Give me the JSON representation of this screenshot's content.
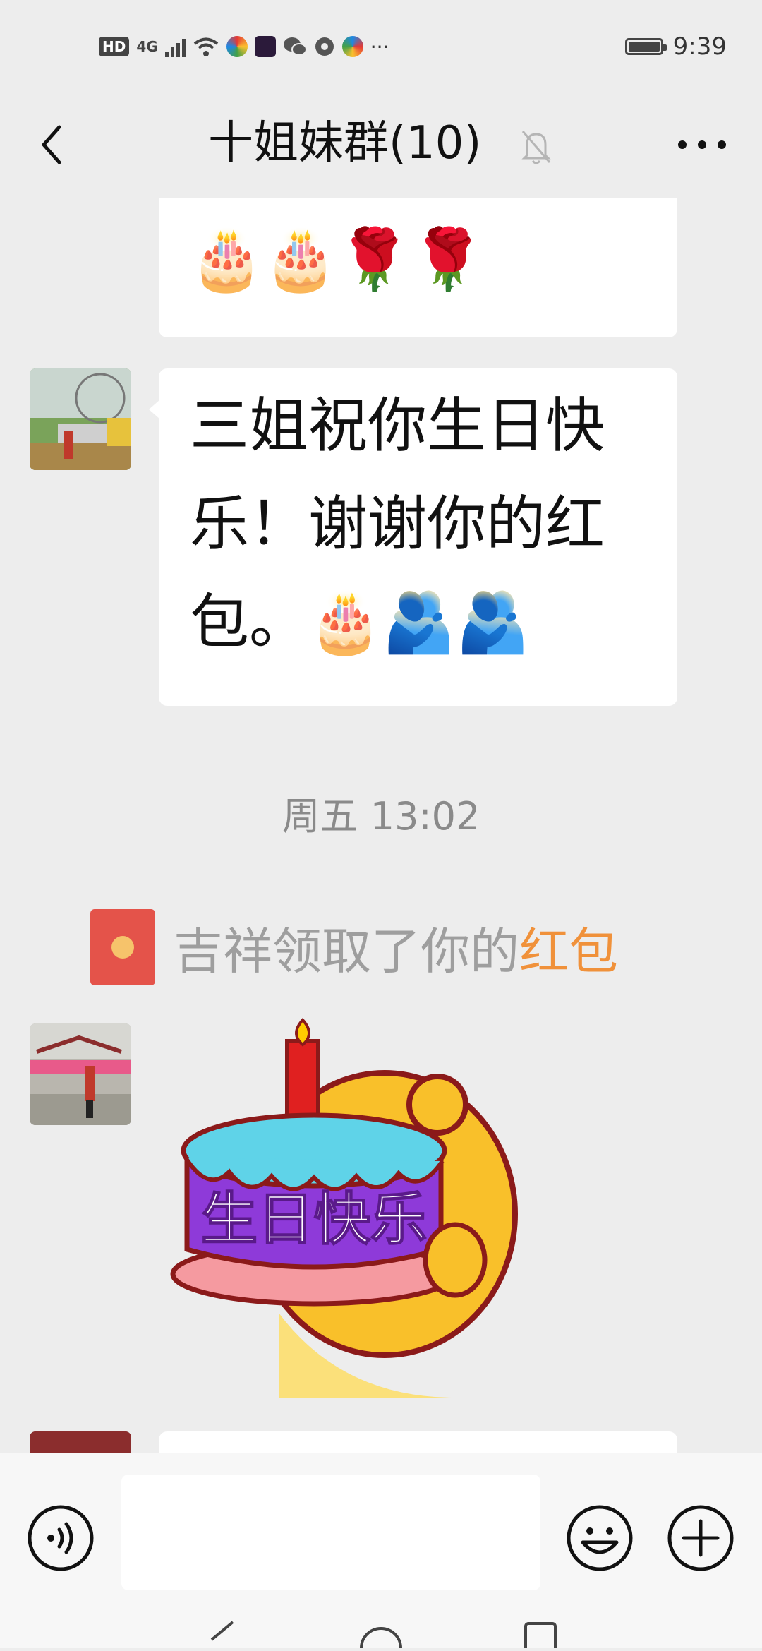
{
  "status_bar": {
    "hd_badge": "HD",
    "network_type": "4G",
    "more_indicator": "···",
    "time": "9:39"
  },
  "header": {
    "title": "十姐妹群(10)",
    "back_icon": "chevron-left-icon",
    "mute_icon": "bell-muted-icon",
    "more_icon": "ellipsis-icon"
  },
  "messages": [
    {
      "type": "text",
      "text": "🎂🎂🌹🌹"
    },
    {
      "type": "text",
      "text": "三姐祝你生日快乐！谢谢你的红包。🎂🫂🫂"
    }
  ],
  "timestamp": "周五 13:02",
  "system_notice": {
    "icon": "red-packet-icon",
    "text": "吉祥领取了你的",
    "link": "红包"
  },
  "sticker": {
    "text": "生日快乐"
  },
  "input_bar": {
    "voice_icon": "voice-icon",
    "input_value": "",
    "emoji_icon": "smiley-icon",
    "plus_icon": "plus-icon"
  },
  "colors": {
    "background": "#ededed",
    "bubble": "#ffffff",
    "link": "#f0913a",
    "red_packet": "#e4534a"
  }
}
